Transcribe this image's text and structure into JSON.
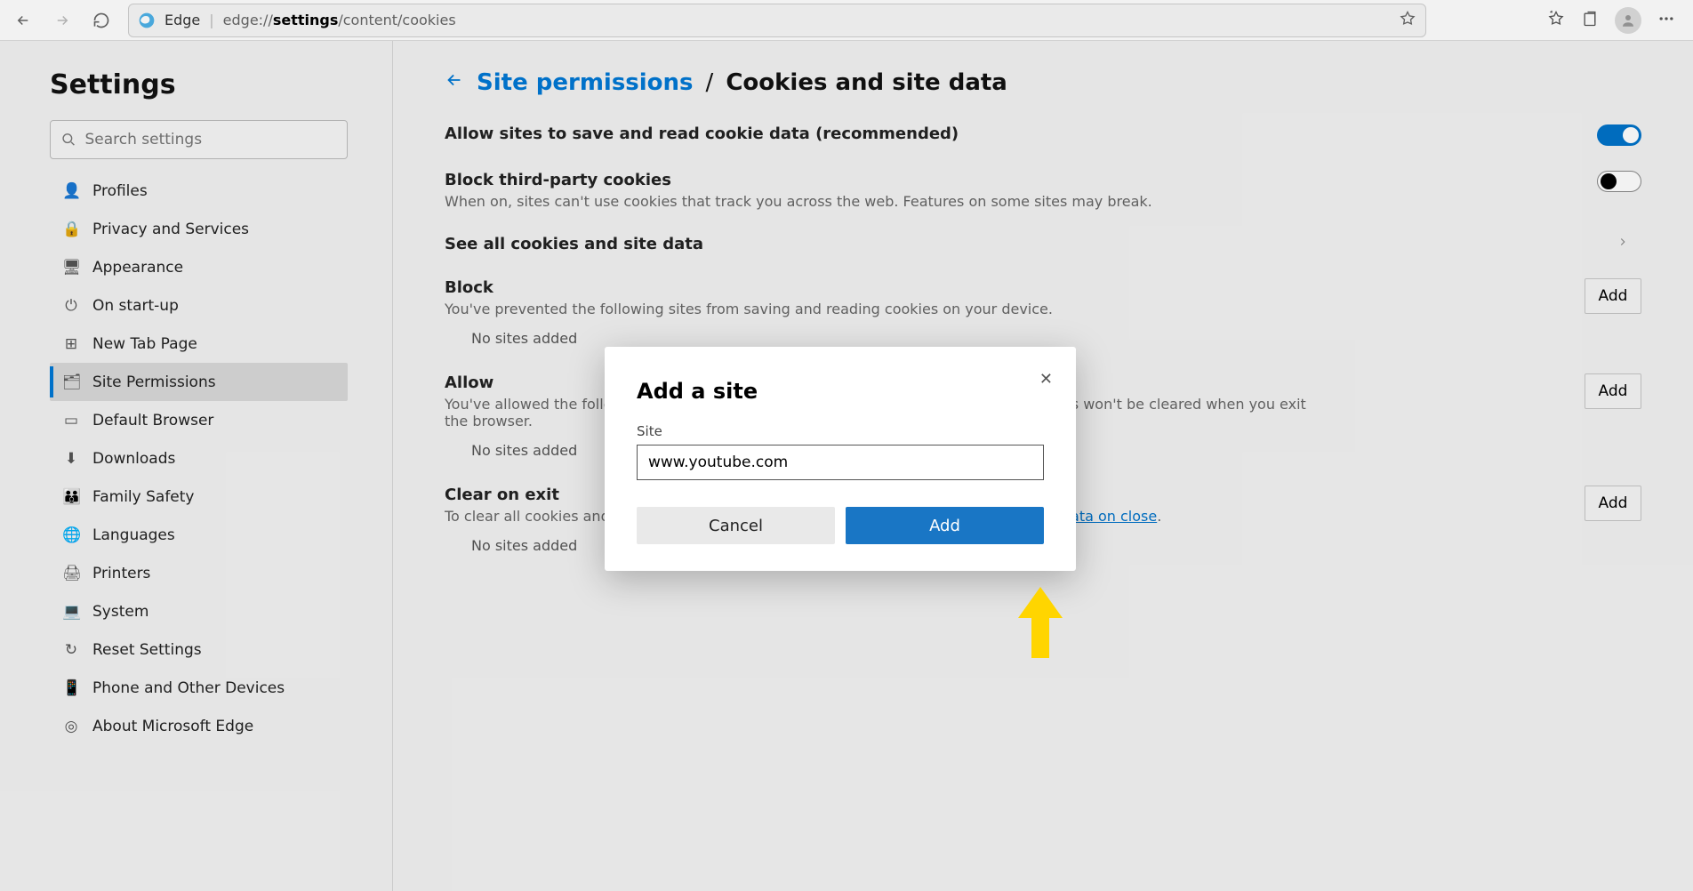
{
  "browser": {
    "name": "Edge",
    "url_prefix": "edge://",
    "url_bold": "settings",
    "url_suffix": "/content/cookies"
  },
  "sidebar": {
    "title": "Settings",
    "search_placeholder": "Search settings",
    "items": [
      {
        "icon": "👤",
        "label": "Profiles"
      },
      {
        "icon": "🔒",
        "label": "Privacy and Services"
      },
      {
        "icon": "🖥",
        "label": "Appearance"
      },
      {
        "icon": "⏻",
        "label": "On start-up"
      },
      {
        "icon": "⊞",
        "label": "New Tab Page"
      },
      {
        "icon": "🗂",
        "label": "Site Permissions"
      },
      {
        "icon": "▭",
        "label": "Default Browser"
      },
      {
        "icon": "⬇",
        "label": "Downloads"
      },
      {
        "icon": "👪",
        "label": "Family Safety"
      },
      {
        "icon": "🌐",
        "label": "Languages"
      },
      {
        "icon": "🖨",
        "label": "Printers"
      },
      {
        "icon": "💻",
        "label": "System"
      },
      {
        "icon": "↻",
        "label": "Reset Settings"
      },
      {
        "icon": "📱",
        "label": "Phone and Other Devices"
      },
      {
        "icon": "◎",
        "label": "About Microsoft Edge"
      }
    ],
    "active_index": 5
  },
  "breadcrumb": {
    "parent": "Site permissions",
    "current": "Cookies and site data"
  },
  "settings": {
    "allow_cookies": {
      "title": "Allow sites to save and read cookie data (recommended)",
      "on": true
    },
    "block_third": {
      "title": "Block third-party cookies",
      "desc": "When on, sites can't use cookies that track you across the web. Features on some sites may break.",
      "on": false
    },
    "see_all": {
      "title": "See all cookies and site data"
    },
    "block": {
      "title": "Block",
      "desc": "You've prevented the following sites from saving and reading cookies on your device.",
      "empty": "No sites added",
      "add": "Add"
    },
    "allow": {
      "title": "Allow",
      "desc": "You've allowed the following sites to save cookies on your device. Cookies for these sites won't be cleared when you exit the browser.",
      "empty": "No sites added",
      "add": "Add"
    },
    "clear_exit": {
      "title": "Clear on exit",
      "desc_pre": "To clear all cookies and site data when you close Microsoft Edge, go to ",
      "link": "Clear browsing data on close",
      "desc_post": ".",
      "empty": "No sites added",
      "add": "Add"
    }
  },
  "dialog": {
    "title": "Add a site",
    "field_label": "Site",
    "value": "www.youtube.com",
    "cancel": "Cancel",
    "add": "Add"
  }
}
